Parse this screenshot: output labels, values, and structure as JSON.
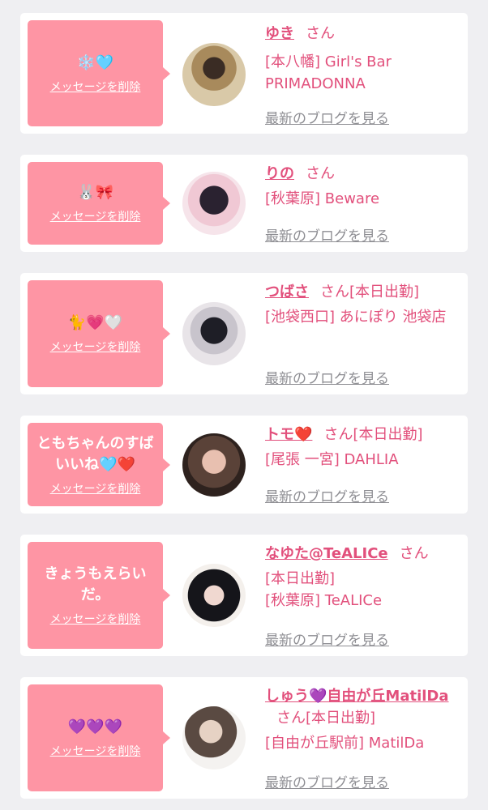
{
  "common": {
    "delete_label": "メッセージを削除",
    "blog_label": "最新のブログを見る",
    "san": "さん"
  },
  "cards": [
    {
      "message": "❄️🩵",
      "name": "ゆき",
      "status": "",
      "location": "[本八幡] Girl's Bar PRIMADONNA"
    },
    {
      "message": "🐰🎀",
      "name": "りの",
      "status": "",
      "location": "[秋葉原] Beware"
    },
    {
      "message": "🐈💗🤍",
      "name": "つばさ",
      "status": "[本日出勤]",
      "location": "[池袋西口] あにぽり 池袋店"
    },
    {
      "message": "ともちゃんのすばいいね🩵❤️",
      "name": "トモ❤️",
      "status": "[本日出勤]",
      "location": "[尾張 一宮] DAHLIA"
    },
    {
      "message": "きょうもえらいだ。",
      "name": "なゆた@TeALICe",
      "status": "[本日出勤]",
      "location": "[秋葉原] TeALICe"
    },
    {
      "message": "💜💜💜",
      "name": "しゅう💜自由が丘MatilDa",
      "status": "[本日出勤]",
      "location": "[自由が丘駅前] MatilDa"
    }
  ]
}
